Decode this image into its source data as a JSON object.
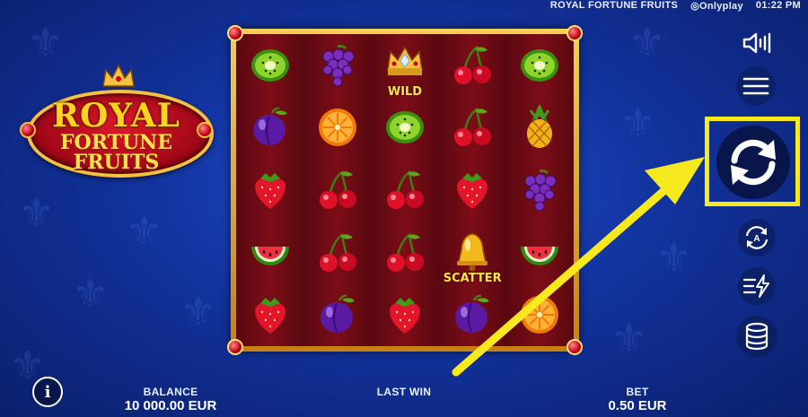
{
  "top_bar": {
    "game_title": "ROYAL FORTUNE FRUITS",
    "provider": "Onlyplay",
    "time": "01:22 PM"
  },
  "logo": {
    "line1": "ROYAL",
    "line2": "FORTUNE",
    "line3": "FRUITS"
  },
  "reels": [
    [
      "kiwi",
      "grapes",
      "wild",
      "cherry",
      "kiwi"
    ],
    [
      "plum",
      "orange",
      "kiwi",
      "cherry",
      "pineapple"
    ],
    [
      "strawberry",
      "cherry",
      "cherry",
      "strawberry",
      "grapes"
    ],
    [
      "watermelon",
      "cherry",
      "cherry",
      "scatter",
      "watermelon"
    ],
    [
      "strawberry",
      "plum",
      "strawberry",
      "plum",
      "orange"
    ]
  ],
  "symbol_labels": {
    "wild": "WILD",
    "scatter": "SCATTER"
  },
  "controls": {
    "sound_icon": "speaker-icon",
    "menu_icon": "hamburger-menu-icon",
    "spin_icon": "spin-refresh-icon",
    "autoplay_icon": "autoplay-icon",
    "turbo_icon": "turbo-lightning-icon",
    "bet_icon": "coin-stack-icon"
  },
  "bottom_bar": {
    "info_label": "i",
    "balance_label": "BALANCE",
    "balance_value": "10 000.00 EUR",
    "last_win_label": "LAST WIN",
    "last_win_value": "",
    "bet_label": "BET",
    "bet_value": "0.50 EUR"
  },
  "colors": {
    "highlight": "#f6ea1e",
    "frame_gold": "#f4c23f",
    "reel_bg": "#6b0b14",
    "background": "#12339e"
  }
}
